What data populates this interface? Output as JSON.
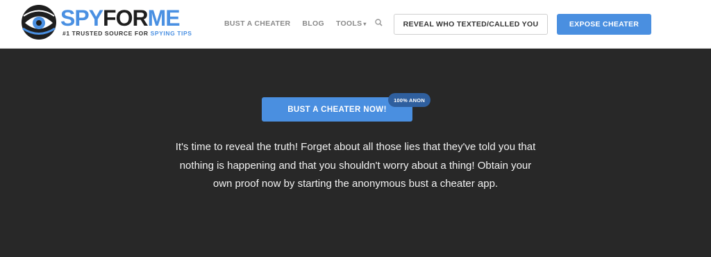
{
  "header": {
    "logo": {
      "part1": "SPY",
      "part2": "FOR",
      "part3": "ME",
      "tagline_prefix": "#1 TRUSTED SOURCE FOR ",
      "tagline_highlight": "SPYING TIPS",
      "icon": "eye-logo-icon"
    },
    "nav": {
      "items": [
        {
          "label": "BUST A CHEATER"
        },
        {
          "label": "BLOG"
        },
        {
          "label": "TOOLS",
          "caret": "▾"
        }
      ],
      "search_icon": "search-icon"
    },
    "reveal_button": "REVEAL WHO TEXTED/CALLED YOU",
    "expose_button": "EXPOSE CHEATER"
  },
  "hero": {
    "cta_label": "BUST A CHEATER NOW!",
    "badge": "100% ANON",
    "copy": "It's time to reveal the truth! Forget about all those lies that they've told you that nothing is happening and that you shouldn't worry about a thing! Obtain your own proof now by starting the anonymous bust a cheater app."
  },
  "colors": {
    "accent": "#4a8fe0",
    "badge": "#2f5f9e",
    "hero_bg": "#282828"
  }
}
